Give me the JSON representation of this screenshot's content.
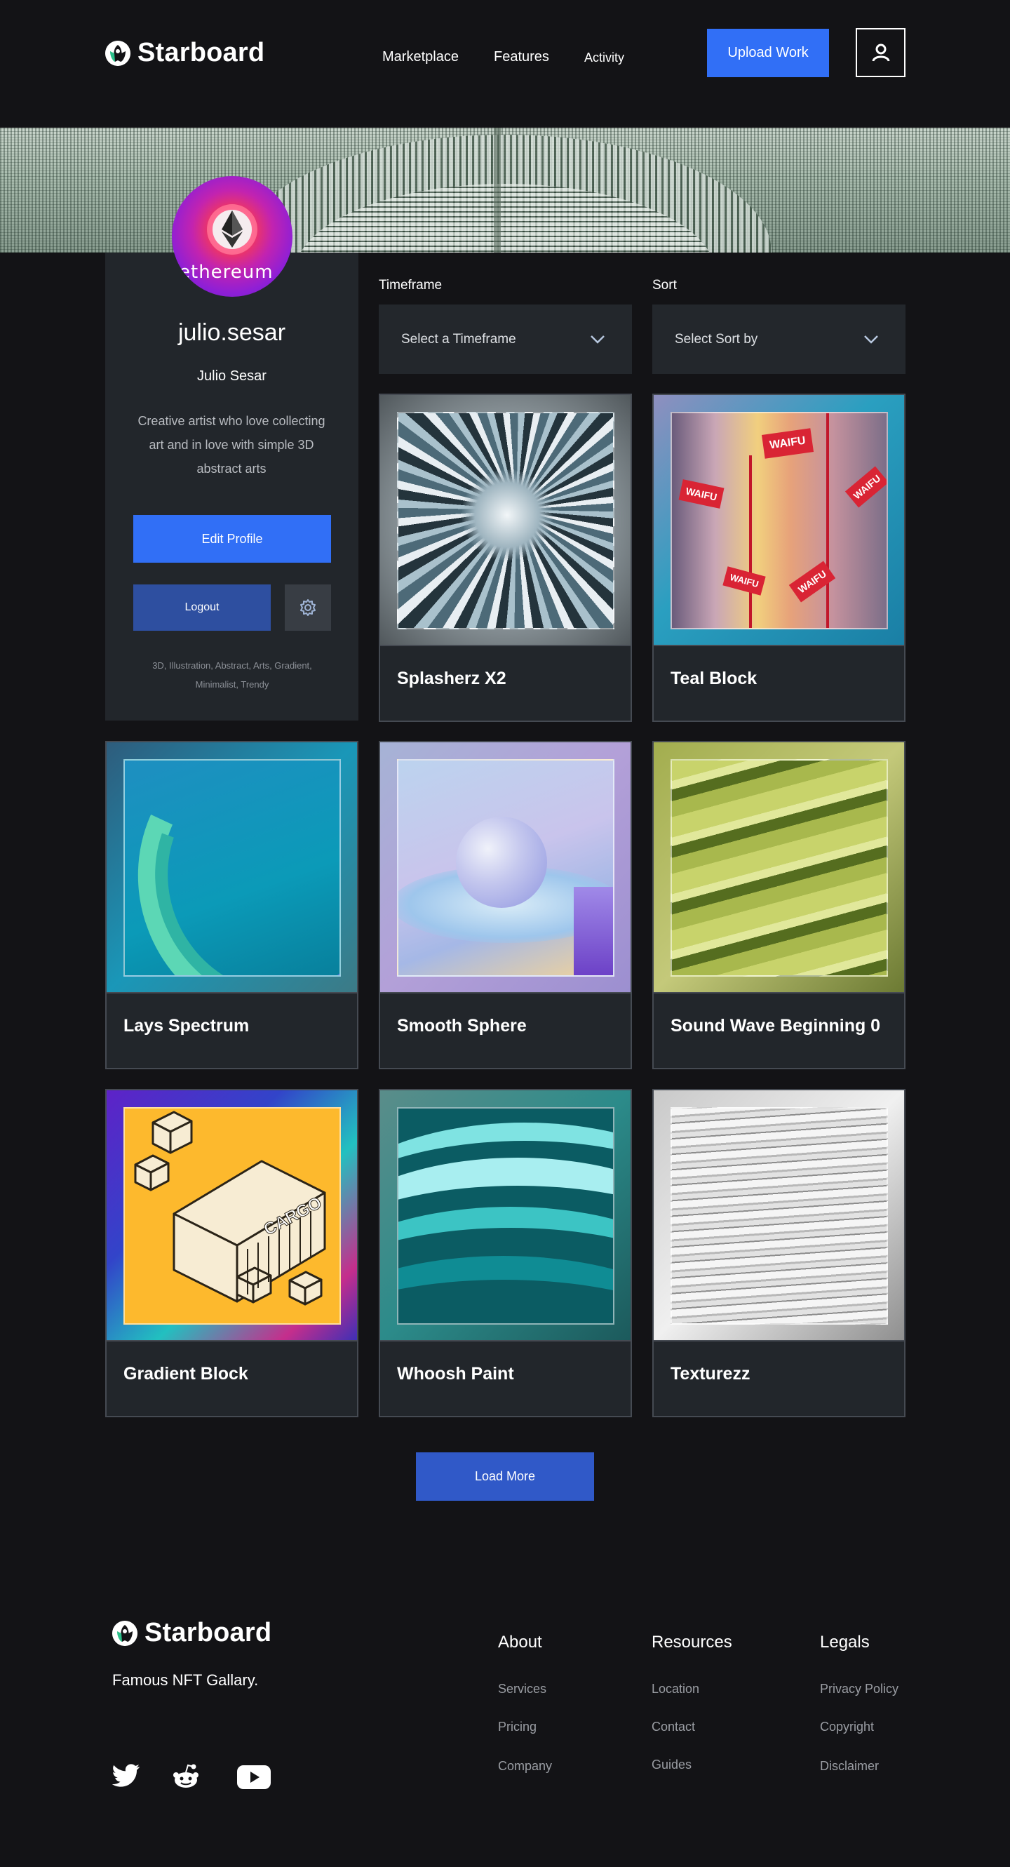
{
  "header": {
    "brand": "Starboard",
    "nav": [
      "Marketplace",
      "Features",
      "Activity"
    ],
    "upload_label": "Upload Work"
  },
  "profile": {
    "avatar_text": "ethereum",
    "username": "julio.sesar",
    "full_name": "Julio Sesar",
    "bio": "Creative artist who love collecting art and in love with simple 3D abstract arts",
    "edit_label": "Edit Profile",
    "logout_label": "Logout",
    "tags": "3D, Illustration, Abstract, Arts, Gradient, Minimalist, Trendy"
  },
  "filters": {
    "timeframe_label": "Timeframe",
    "timeframe_value": "Select a Timeframe",
    "sort_label": "Sort",
    "sort_value": "Select Sort by"
  },
  "artworks": [
    {
      "title": "Splasherz X2"
    },
    {
      "title": "Teal Block",
      "badge": "WAIFU"
    },
    {
      "title": "Lays Spectrum"
    },
    {
      "title": "Smooth Sphere"
    },
    {
      "title": "Sound Wave Beginning 0"
    },
    {
      "title": "Gradient Block",
      "art_text": "CARGO"
    },
    {
      "title": "Whoosh Paint"
    },
    {
      "title": "Texturezz"
    }
  ],
  "load_more_label": "Load More",
  "footer": {
    "brand": "Starboard",
    "tagline": "Famous NFT Gallary.",
    "columns": [
      {
        "title": "About",
        "links": [
          "Services",
          "Pricing",
          "Company"
        ]
      },
      {
        "title": "Resources",
        "links": [
          "Location",
          "Contact",
          "Guides"
        ]
      },
      {
        "title": "Legals",
        "links": [
          "Privacy Policy",
          "Copyright",
          "Disclaimer"
        ]
      }
    ]
  },
  "colors": {
    "background": "#131316",
    "card": "#22262b",
    "accent": "#316ff6"
  }
}
